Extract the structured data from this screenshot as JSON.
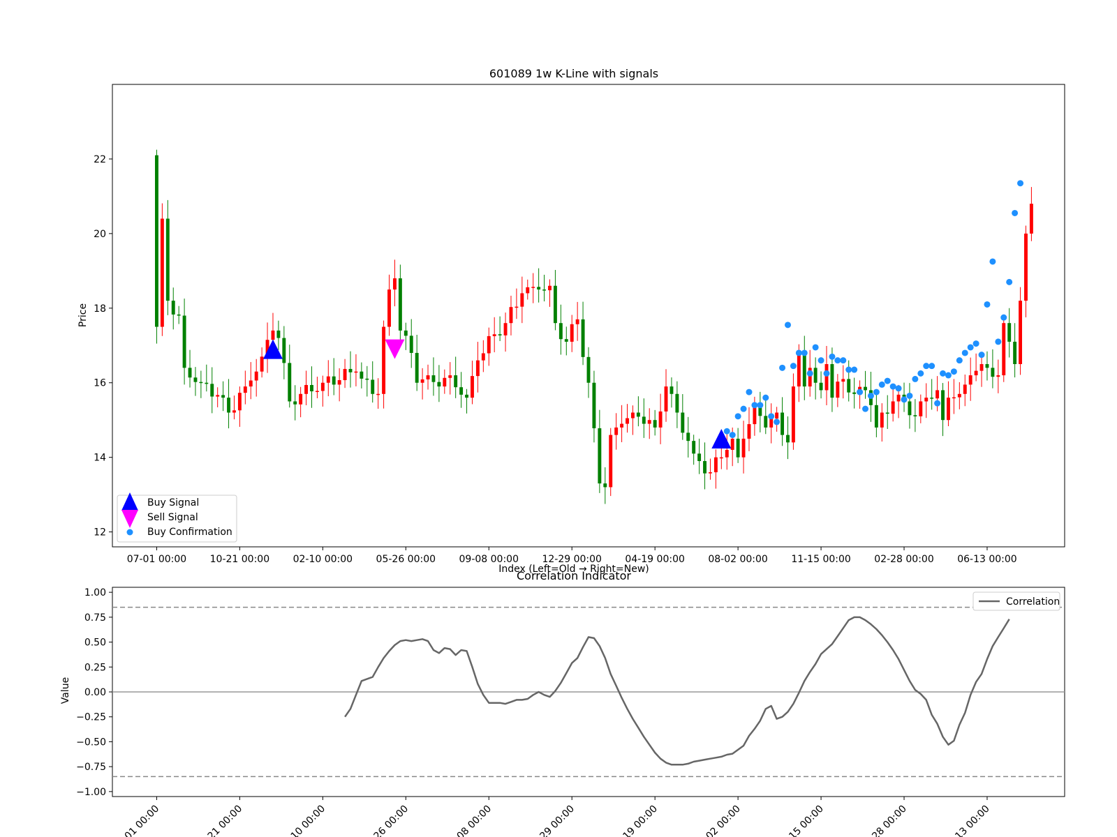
{
  "colors": {
    "up": "#008000",
    "down": "#ff0000",
    "buy_signal": "#0000ff",
    "sell_signal": "#ff00ff",
    "buy_confirmation": "#1e90ff",
    "correlation": "#666666",
    "threshold": "#888888",
    "zero_line": "#999999"
  },
  "chart_data": [
    {
      "type": "candlestick",
      "title": "601089 1w K-Line with signals",
      "xlabel": "Index (Left=Old → Right=New)",
      "ylabel": "Price",
      "xlim": [
        -8,
        164
      ],
      "ylim": [
        11.6,
        24.0
      ],
      "y_ticks": [
        12,
        14,
        16,
        18,
        20,
        22
      ],
      "x_ticks": [
        {
          "index": 0,
          "label": "07-01 00:00"
        },
        {
          "index": 15,
          "label": "10-21 00:00"
        },
        {
          "index": 30,
          "label": "02-10 00:00"
        },
        {
          "index": 45,
          "label": "05-26 00:00"
        },
        {
          "index": 60,
          "label": "09-08 00:00"
        },
        {
          "index": 75,
          "label": "12-29 00:00"
        },
        {
          "index": 90,
          "label": "04-19 00:00"
        },
        {
          "index": 105,
          "label": "08-02 00:00"
        },
        {
          "index": 120,
          "label": "11-15 00:00"
        },
        {
          "index": 135,
          "label": "02-28 00:00"
        },
        {
          "index": 150,
          "label": "06-13 00:00"
        }
      ],
      "close_anchors": [
        [
          0,
          17.5
        ],
        [
          1,
          20.4
        ],
        [
          2,
          18.2
        ],
        [
          4,
          17.8
        ],
        [
          5,
          16.4
        ],
        [
          8,
          16.0
        ],
        [
          12,
          15.6
        ],
        [
          13,
          15.2
        ],
        [
          16,
          15.9
        ],
        [
          19,
          16.7
        ],
        [
          21,
          17.4
        ],
        [
          22,
          17.2
        ],
        [
          24,
          15.5
        ],
        [
          26,
          15.7
        ],
        [
          30,
          16.0
        ],
        [
          36,
          16.3
        ],
        [
          39,
          15.7
        ],
        [
          40,
          15.7
        ],
        [
          41,
          17.5
        ],
        [
          42,
          18.5
        ],
        [
          43,
          18.8
        ],
        [
          44,
          17.4
        ],
        [
          46,
          16.8
        ],
        [
          47,
          16.0
        ],
        [
          49,
          16.2
        ],
        [
          51,
          15.9
        ],
        [
          53,
          16.2
        ],
        [
          56,
          15.6
        ],
        [
          58,
          16.6
        ],
        [
          61,
          17.3
        ],
        [
          63,
          17.6
        ],
        [
          66,
          18.4
        ],
        [
          69,
          18.5
        ],
        [
          71,
          18.6
        ],
        [
          72,
          17.6
        ],
        [
          74,
          17.1
        ],
        [
          76,
          17.7
        ],
        [
          78,
          16.0
        ],
        [
          80,
          13.3
        ],
        [
          81,
          13.2
        ],
        [
          82,
          14.6
        ],
        [
          84,
          14.9
        ],
        [
          86,
          15.2
        ],
        [
          89,
          15.0
        ],
        [
          90,
          14.8
        ],
        [
          92,
          15.9
        ],
        [
          94,
          15.2
        ],
        [
          97,
          14.1
        ],
        [
          98,
          13.9
        ],
        [
          100,
          13.6
        ],
        [
          101,
          14.0
        ],
        [
          103,
          14.2
        ],
        [
          104,
          14.5
        ],
        [
          105,
          14.0
        ],
        [
          106,
          14.5
        ],
        [
          108,
          15.4
        ],
        [
          110,
          14.8
        ],
        [
          112,
          15.2
        ],
        [
          113,
          14.6
        ],
        [
          114,
          14.4
        ],
        [
          115,
          15.9
        ],
        [
          116,
          16.8
        ],
        [
          117,
          15.9
        ],
        [
          118,
          16.4
        ],
        [
          119,
          16.0
        ],
        [
          120,
          15.8
        ],
        [
          121,
          16.5
        ],
        [
          122,
          15.6
        ],
        [
          124,
          16.1
        ],
        [
          126,
          15.7
        ],
        [
          128,
          15.8
        ],
        [
          129,
          15.4
        ],
        [
          130,
          14.8
        ],
        [
          131,
          15.2
        ],
        [
          133,
          15.5
        ],
        [
          135,
          15.5
        ],
        [
          137,
          15.1
        ],
        [
          139,
          15.6
        ],
        [
          141,
          15.8
        ],
        [
          142,
          15.0
        ],
        [
          143,
          15.6
        ],
        [
          145,
          15.7
        ],
        [
          147,
          16.2
        ],
        [
          150,
          16.4
        ],
        [
          152,
          16.2
        ],
        [
          153,
          17.6
        ],
        [
          154,
          17.1
        ],
        [
          155,
          16.5
        ],
        [
          156,
          18.2
        ],
        [
          157,
          20.0
        ],
        [
          158,
          20.8
        ]
      ],
      "first_open": 22.1,
      "signals": [
        {
          "series": "Buy Signal",
          "index": 21,
          "price": 16.9
        },
        {
          "series": "Sell Signal",
          "index": 43,
          "price": 16.9
        },
        {
          "series": "Buy Signal",
          "index": 102,
          "price": 14.5
        }
      ],
      "buy_confirmations": [
        [
          103,
          14.7
        ],
        [
          104,
          14.6
        ],
        [
          105,
          15.1
        ],
        [
          106,
          15.3
        ],
        [
          107,
          15.75
        ],
        [
          108,
          15.4
        ],
        [
          109,
          15.4
        ],
        [
          110,
          15.6
        ],
        [
          111,
          15.1
        ],
        [
          112,
          14.95
        ],
        [
          113,
          16.4
        ],
        [
          114,
          17.55
        ],
        [
          115,
          16.45
        ],
        [
          116,
          16.8
        ],
        [
          117,
          16.8
        ],
        [
          118,
          16.25
        ],
        [
          119,
          16.95
        ],
        [
          120,
          16.6
        ],
        [
          121,
          16.25
        ],
        [
          122,
          16.7
        ],
        [
          123,
          16.6
        ],
        [
          124,
          16.6
        ],
        [
          125,
          16.35
        ],
        [
          126,
          16.35
        ],
        [
          127,
          15.75
        ],
        [
          128,
          15.3
        ],
        [
          129,
          15.65
        ],
        [
          130,
          15.75
        ],
        [
          131,
          15.95
        ],
        [
          132,
          16.05
        ],
        [
          133,
          15.9
        ],
        [
          134,
          15.85
        ],
        [
          135,
          15.55
        ],
        [
          136,
          15.65
        ],
        [
          137,
          16.1
        ],
        [
          138,
          16.25
        ],
        [
          139,
          16.45
        ],
        [
          140,
          16.45
        ],
        [
          141,
          15.45
        ],
        [
          142,
          16.25
        ],
        [
          143,
          16.2
        ],
        [
          144,
          16.3
        ],
        [
          145,
          16.6
        ],
        [
          146,
          16.8
        ],
        [
          147,
          16.95
        ],
        [
          148,
          17.05
        ],
        [
          149,
          16.75
        ],
        [
          150,
          18.1
        ],
        [
          151,
          19.25
        ],
        [
          152,
          17.1
        ],
        [
          153,
          17.75
        ],
        [
          154,
          18.7
        ],
        [
          155,
          20.55
        ],
        [
          156,
          21.35
        ]
      ],
      "legend": {
        "placement": "lower-left",
        "entries": [
          "Buy Signal",
          "Sell Signal",
          "Buy Confirmation"
        ]
      }
    },
    {
      "type": "line",
      "title": "Correlation Indicator",
      "ylabel": "Value",
      "xlim": [
        -8,
        164
      ],
      "ylim": [
        -1.05,
        1.05
      ],
      "y_ticks": [
        1.0,
        0.75,
        0.5,
        0.25,
        0.0,
        -0.25,
        -0.5,
        -0.75,
        -1.0
      ],
      "y_tick_labels": [
        "1.00",
        "0.75",
        "0.50",
        "0.25",
        "0.00",
        "−0.25",
        "−0.50",
        "−0.75",
        "−1.00"
      ],
      "x_tick_labels_partial": [
        "01 00:00",
        "21 00:00",
        "10 00:00",
        "26 00:00",
        "08 00:00",
        "29 00:00",
        "19 00:00",
        "02 00:00",
        "15 00:00",
        "28 00:00",
        "13 00:00"
      ],
      "reference_lines": [
        0.85,
        0.0,
        -0.85
      ],
      "series": [
        {
          "name": "Correlation",
          "points": [
            [
              34,
              -0.25
            ],
            [
              35,
              -0.17
            ],
            [
              36,
              -0.03
            ],
            [
              37,
              0.11
            ],
            [
              38,
              0.13
            ],
            [
              39,
              0.15
            ],
            [
              40,
              0.25
            ],
            [
              41,
              0.34
            ],
            [
              42,
              0.41
            ],
            [
              43,
              0.47
            ],
            [
              44,
              0.51
            ],
            [
              45,
              0.52
            ],
            [
              46,
              0.51
            ],
            [
              47,
              0.52
            ],
            [
              48,
              0.53
            ],
            [
              49,
              0.51
            ],
            [
              50,
              0.42
            ],
            [
              51,
              0.39
            ],
            [
              52,
              0.44
            ],
            [
              53,
              0.43
            ],
            [
              54,
              0.37
            ],
            [
              55,
              0.42
            ],
            [
              56,
              0.41
            ],
            [
              57,
              0.25
            ],
            [
              58,
              0.08
            ],
            [
              59,
              -0.03
            ],
            [
              60,
              -0.11
            ],
            [
              61,
              -0.11
            ],
            [
              62,
              -0.11
            ],
            [
              63,
              -0.12
            ],
            [
              64,
              -0.1
            ],
            [
              65,
              -0.08
            ],
            [
              66,
              -0.08
            ],
            [
              67,
              -0.07
            ],
            [
              68,
              -0.03
            ],
            [
              69,
              0.0
            ],
            [
              70,
              -0.03
            ],
            [
              71,
              -0.05
            ],
            [
              72,
              0.01
            ],
            [
              73,
              0.09
            ],
            [
              74,
              0.19
            ],
            [
              75,
              0.29
            ],
            [
              76,
              0.34
            ],
            [
              77,
              0.45
            ],
            [
              78,
              0.55
            ],
            [
              79,
              0.54
            ],
            [
              80,
              0.46
            ],
            [
              81,
              0.34
            ],
            [
              82,
              0.18
            ],
            [
              83,
              0.06
            ],
            [
              84,
              -0.06
            ],
            [
              85,
              -0.17
            ],
            [
              86,
              -0.27
            ],
            [
              87,
              -0.36
            ],
            [
              88,
              -0.45
            ],
            [
              89,
              -0.53
            ],
            [
              90,
              -0.61
            ],
            [
              91,
              -0.67
            ],
            [
              92,
              -0.71
            ],
            [
              93,
              -0.73
            ],
            [
              94,
              -0.73
            ],
            [
              95,
              -0.73
            ],
            [
              96,
              -0.72
            ],
            [
              97,
              -0.7
            ],
            [
              98,
              -0.69
            ],
            [
              99,
              -0.68
            ],
            [
              100,
              -0.67
            ],
            [
              101,
              -0.66
            ],
            [
              102,
              -0.65
            ],
            [
              103,
              -0.63
            ],
            [
              104,
              -0.62
            ],
            [
              105,
              -0.58
            ],
            [
              106,
              -0.54
            ],
            [
              107,
              -0.44
            ],
            [
              108,
              -0.37
            ],
            [
              109,
              -0.29
            ],
            [
              110,
              -0.17
            ],
            [
              111,
              -0.14
            ],
            [
              112,
              -0.27
            ],
            [
              113,
              -0.25
            ],
            [
              114,
              -0.2
            ],
            [
              115,
              -0.12
            ],
            [
              116,
              -0.01
            ],
            [
              117,
              0.11
            ],
            [
              118,
              0.2
            ],
            [
              119,
              0.28
            ],
            [
              120,
              0.38
            ],
            [
              121,
              0.43
            ],
            [
              122,
              0.48
            ],
            [
              123,
              0.56
            ],
            [
              124,
              0.64
            ],
            [
              125,
              0.72
            ],
            [
              126,
              0.75
            ],
            [
              127,
              0.75
            ],
            [
              128,
              0.72
            ],
            [
              129,
              0.68
            ],
            [
              130,
              0.63
            ],
            [
              131,
              0.57
            ],
            [
              132,
              0.5
            ],
            [
              133,
              0.42
            ],
            [
              134,
              0.33
            ],
            [
              135,
              0.22
            ],
            [
              136,
              0.11
            ],
            [
              137,
              0.02
            ],
            [
              138,
              -0.02
            ],
            [
              139,
              -0.08
            ],
            [
              140,
              -0.23
            ],
            [
              141,
              -0.32
            ],
            [
              142,
              -0.45
            ],
            [
              143,
              -0.53
            ],
            [
              144,
              -0.49
            ],
            [
              145,
              -0.33
            ],
            [
              146,
              -0.21
            ],
            [
              147,
              -0.03
            ],
            [
              148,
              0.1
            ],
            [
              149,
              0.18
            ],
            [
              150,
              0.33
            ],
            [
              151,
              0.46
            ],
            [
              152,
              0.55
            ],
            [
              153,
              0.64
            ],
            [
              154,
              0.73
            ]
          ]
        }
      ],
      "legend": {
        "placement": "top-right",
        "entries": [
          "Correlation"
        ]
      }
    }
  ]
}
